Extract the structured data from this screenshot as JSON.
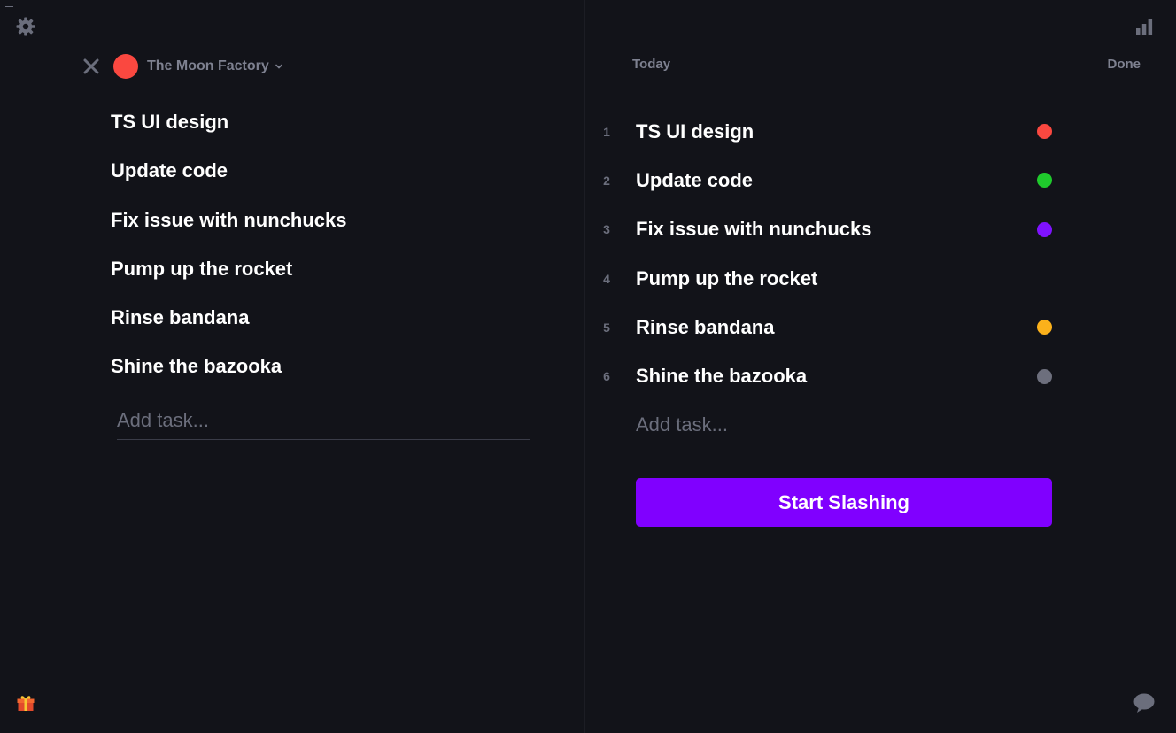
{
  "project": {
    "name": "The Moon Factory",
    "color": "#fa4840"
  },
  "left_panel": {
    "tasks": [
      "TS UI design",
      "Update code",
      "Fix issue with nunchucks",
      "Pump up the rocket",
      "Rinse bandana",
      "Shine the bazooka"
    ],
    "add_placeholder": "Add task..."
  },
  "right_panel": {
    "today_label": "Today",
    "done_label": "Done",
    "tasks": [
      {
        "num": "1",
        "label": "TS UI design",
        "color": "#fa4840"
      },
      {
        "num": "2",
        "label": "Update code",
        "color": "#1fca2c"
      },
      {
        "num": "3",
        "label": "Fix issue with nunchucks",
        "color": "#7f12ff"
      },
      {
        "num": "4",
        "label": "Pump up the rocket",
        "color": ""
      },
      {
        "num": "5",
        "label": "Rinse bandana",
        "color": "#fbb11b"
      },
      {
        "num": "6",
        "label": "Shine the bazooka",
        "color": "#6d6f7d"
      }
    ],
    "add_placeholder": "Add task...",
    "start_button": "Start Slashing"
  },
  "icons": {
    "settings": "gear-icon",
    "stats": "bar-chart-icon",
    "close": "close-icon",
    "dropdown": "chevron-down-icon",
    "gift": "gift-icon",
    "chat": "chat-bubble-icon"
  },
  "colors": {
    "background": "#121319",
    "accent": "#8000ff",
    "muted_text": "#7e8190"
  }
}
